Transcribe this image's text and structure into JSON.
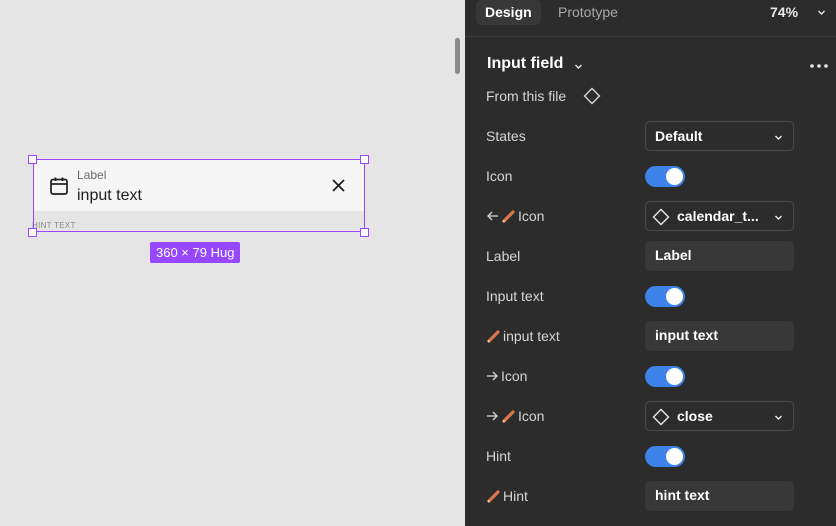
{
  "canvas": {
    "field_label": "Label",
    "field_value": "input text",
    "hint": "HINT TEXT",
    "size_badge": "360 × 79 Hug"
  },
  "header": {
    "tab_design": "Design",
    "tab_prototype": "Prototype",
    "zoom": "74%"
  },
  "component": {
    "title": "Input field",
    "source": "From this file"
  },
  "props": {
    "states": {
      "label": "States",
      "value": "Default"
    },
    "icon": {
      "label": "Icon",
      "on": true
    },
    "left_icon": {
      "label": "Icon",
      "value": "calendar_t..."
    },
    "label": {
      "label": "Label",
      "value": "Label"
    },
    "input_text": {
      "label": "Input text",
      "on": true
    },
    "input_text_value": {
      "label": "input text",
      "value": "input text"
    },
    "right_icon_toggle": {
      "label": "Icon",
      "on": true
    },
    "right_icon": {
      "label": "Icon",
      "value": "close"
    },
    "hint": {
      "label": "Hint",
      "on": true
    },
    "hint_value": {
      "label": "Hint",
      "value": "hint text"
    }
  },
  "colors": {
    "selection": "#9747ff",
    "toggle_on": "#3d82e8",
    "panel_bg": "#2c2c2c",
    "canvas_bg": "#e5e5e5"
  }
}
